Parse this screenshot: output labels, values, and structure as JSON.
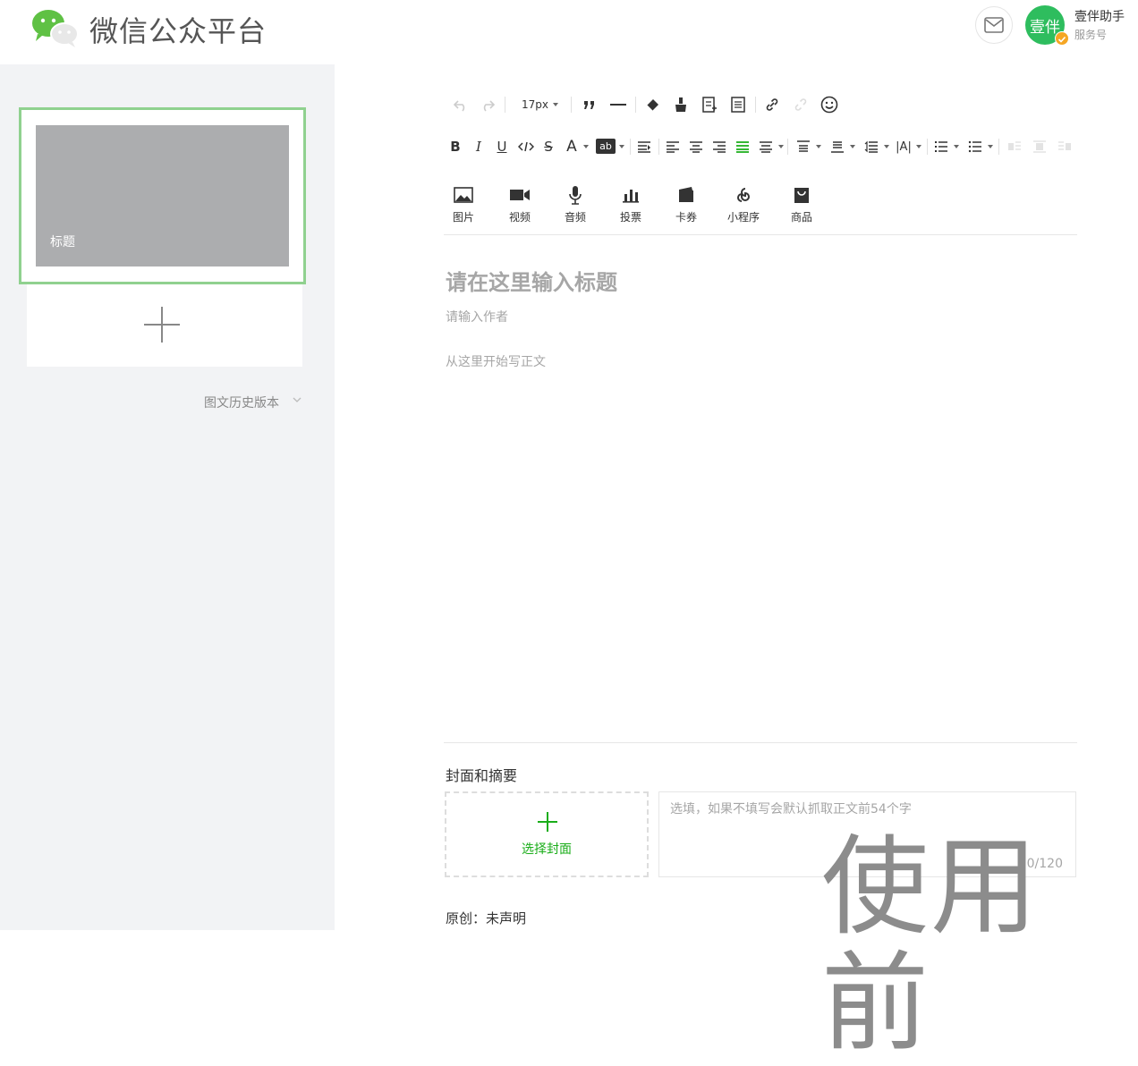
{
  "header": {
    "brand": "微信公众平台",
    "account": {
      "avatar_text": "壹伴",
      "name": "壹伴助手",
      "type": "服务号"
    }
  },
  "left": {
    "card_title": "标题",
    "history_label": "图文历史版本"
  },
  "toolbar": {
    "font_size": "17px",
    "insert": [
      {
        "label": "图片",
        "icon": "image-icon"
      },
      {
        "label": "视频",
        "icon": "video-icon"
      },
      {
        "label": "音频",
        "icon": "audio-icon"
      },
      {
        "label": "投票",
        "icon": "vote-icon"
      },
      {
        "label": "卡券",
        "icon": "coupon-icon"
      },
      {
        "label": "小程序",
        "icon": "mini-program-icon"
      },
      {
        "label": "商品",
        "icon": "product-icon"
      }
    ]
  },
  "editor": {
    "title_placeholder": "请在这里输入标题",
    "author_placeholder": "请输入作者",
    "body_placeholder": "从这里开始写正文"
  },
  "cover": {
    "section_title": "封面和摘要",
    "choose_label": "选择封面",
    "summary_placeholder": "选填，如果不填写会默认抓取正文前54个字",
    "summary_count": "0/120"
  },
  "original": {
    "label": "原创：未声明"
  },
  "watermark": "使用前",
  "colors": {
    "accent_green": "#1aad19",
    "card_border": "#90d18f"
  }
}
